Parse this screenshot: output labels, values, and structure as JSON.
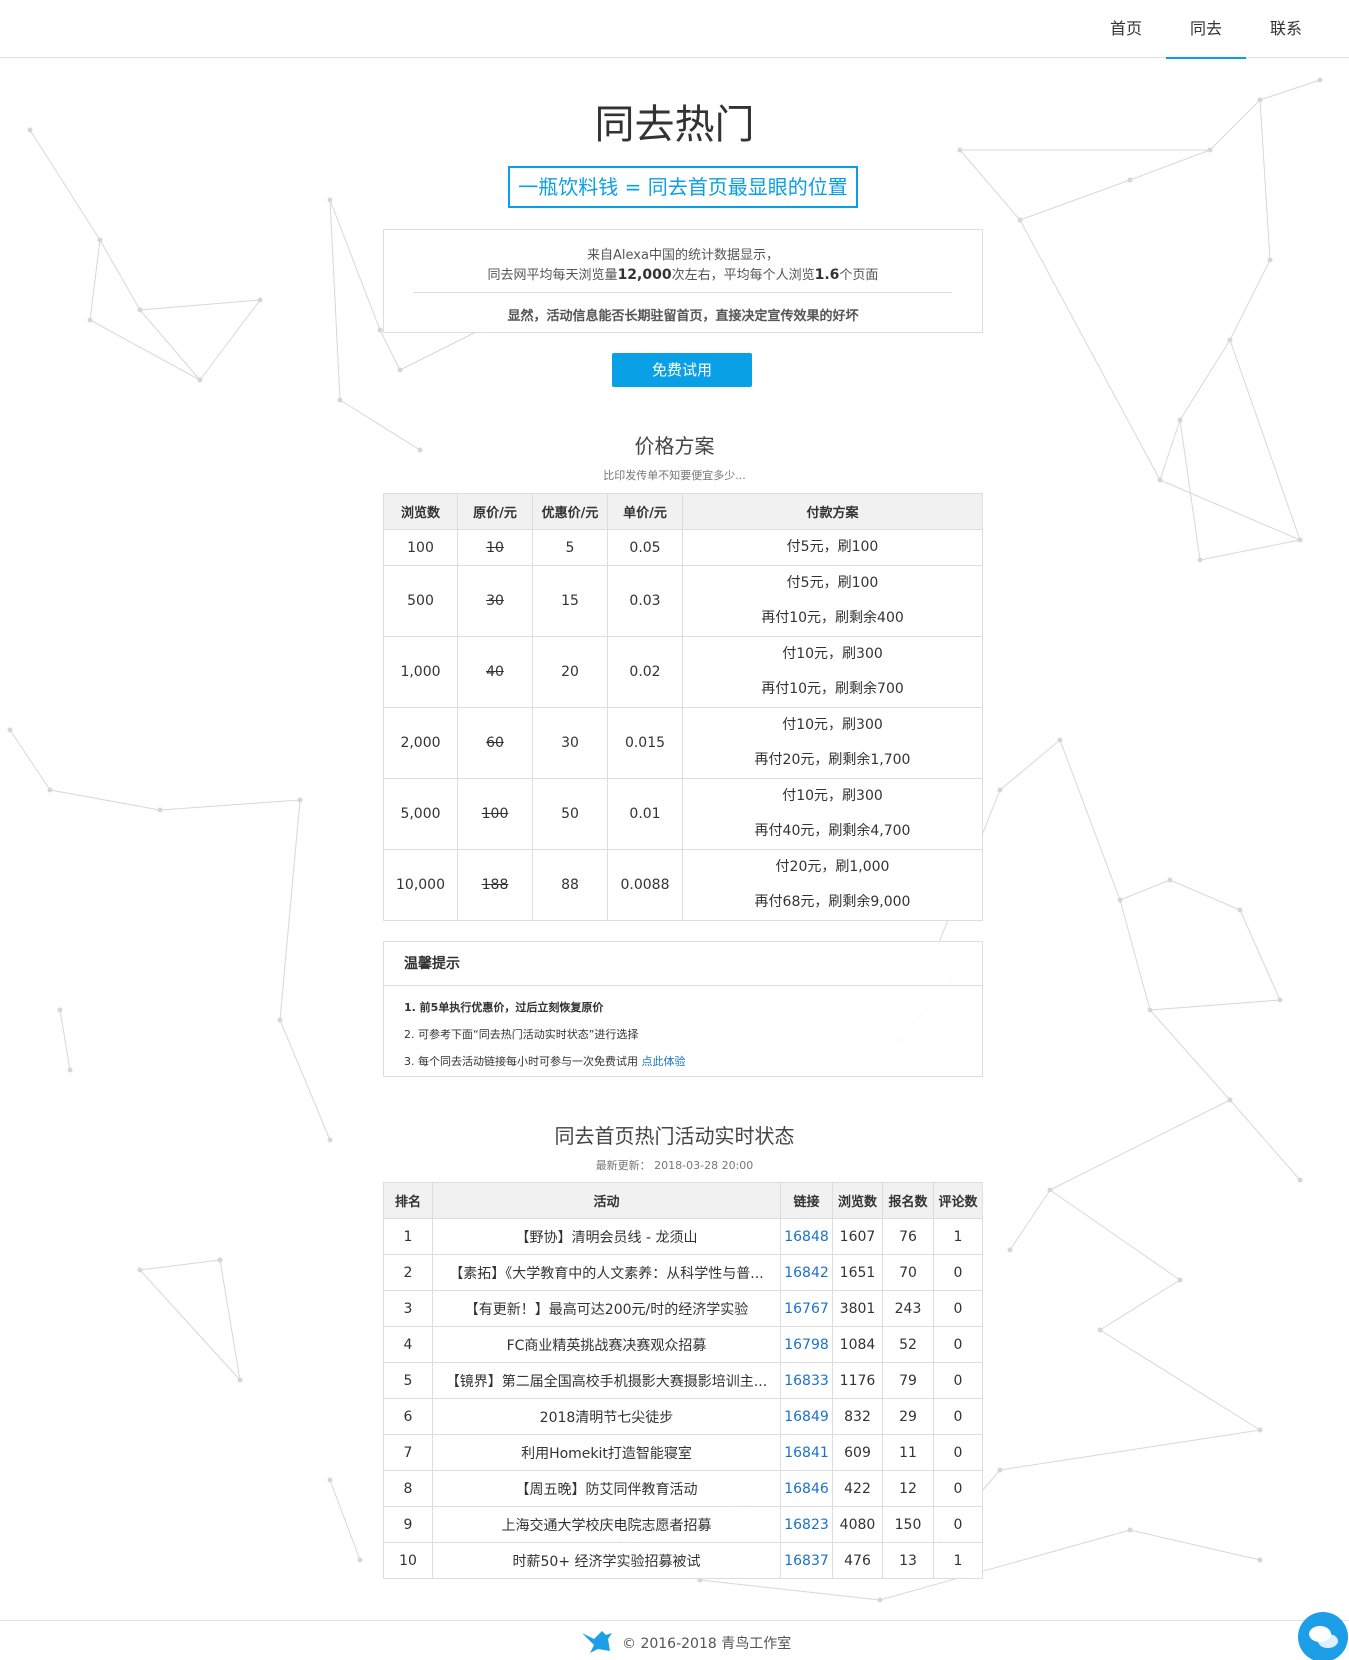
{
  "nav": {
    "items": [
      "首页",
      "同去",
      "联系"
    ],
    "active_index": 1
  },
  "hero": {
    "title": "同去热门",
    "slogan": "一瓶饮料钱 = 同去首页最显眼的位置"
  },
  "stats": {
    "line1": "来自Alexa中国的统计数据显示，",
    "line2_pre": "同去网平均每天浏览量",
    "line2_b1": "12,000",
    "line2_mid": "次左右，平均每个人浏览",
    "line2_b2": "1.6",
    "line2_post": "个页面",
    "line3": "显然，活动信息能否长期驻留首页，直接决定宣传效果的好坏"
  },
  "trial_button": "免费试用",
  "pricing": {
    "title": "价格方案",
    "subtitle": "比印发传单不知要便宜多少...",
    "headers": [
      "浏览数",
      "原价/元",
      "优惠价/元",
      "单价/元",
      "付款方案"
    ],
    "rows": [
      {
        "views": "100",
        "orig": "10",
        "deal": "5",
        "unit": "0.05",
        "plan": [
          "付5元，刷100"
        ]
      },
      {
        "views": "500",
        "orig": "30",
        "deal": "15",
        "unit": "0.03",
        "plan": [
          "付5元，刷100",
          "再付10元，刷剩余400"
        ]
      },
      {
        "views": "1,000",
        "orig": "40",
        "deal": "20",
        "unit": "0.02",
        "plan": [
          "付10元，刷300",
          "再付10元，刷剩余700"
        ]
      },
      {
        "views": "2,000",
        "orig": "60",
        "deal": "30",
        "unit": "0.015",
        "plan": [
          "付10元，刷300",
          "再付20元，刷剩余1,700"
        ]
      },
      {
        "views": "5,000",
        "orig": "100",
        "deal": "50",
        "unit": "0.01",
        "plan": [
          "付10元，刷300",
          "再付40元，刷剩余4,700"
        ]
      },
      {
        "views": "10,000",
        "orig": "188",
        "deal": "88",
        "unit": "0.0088",
        "plan": [
          "付20元，刷1,000",
          "再付68元，刷剩余9,000"
        ]
      }
    ]
  },
  "tips": {
    "title": "温馨提示",
    "item1": "1. 前5单执行优惠价，过后立刻恢复原价",
    "item2": "2. 可参考下面“同去热门活动实时状态”进行选择",
    "item3": "3. 每个同去活动链接每小时可参与一次免费试用 ",
    "item3_link": "点此体验"
  },
  "ranking": {
    "title": "同去首页热门活动实时状态",
    "updated": "最新更新： 2018-03-28 20:00",
    "headers": [
      "排名",
      "活动",
      "链接",
      "浏览数",
      "报名数",
      "评论数"
    ],
    "rows": [
      {
        "rank": "1",
        "name": "【野协】清明会员线 - 龙须山",
        "link": "16848",
        "views": "1607",
        "signups": "76",
        "comments": "1"
      },
      {
        "rank": "2",
        "name": "【素拓】《大学教育中的人文素养：从科学性与普...",
        "link": "16842",
        "views": "1651",
        "signups": "70",
        "comments": "0"
      },
      {
        "rank": "3",
        "name": "【有更新！】最高可达200元/时的经济学实验",
        "link": "16767",
        "views": "3801",
        "signups": "243",
        "comments": "0"
      },
      {
        "rank": "4",
        "name": "FC商业精英挑战赛决赛观众招募",
        "link": "16798",
        "views": "1084",
        "signups": "52",
        "comments": "0"
      },
      {
        "rank": "5",
        "name": "【镜界】第二届全国高校手机摄影大赛摄影培训主...",
        "link": "16833",
        "views": "1176",
        "signups": "79",
        "comments": "0"
      },
      {
        "rank": "6",
        "name": "2018清明节七尖徒步",
        "link": "16849",
        "views": "832",
        "signups": "29",
        "comments": "0"
      },
      {
        "rank": "7",
        "name": "利用Homekit打造智能寝室",
        "link": "16841",
        "views": "609",
        "signups": "11",
        "comments": "0"
      },
      {
        "rank": "8",
        "name": "【周五晚】防艾同伴教育活动",
        "link": "16846",
        "views": "422",
        "signups": "12",
        "comments": "0"
      },
      {
        "rank": "9",
        "name": "上海交通大学校庆电院志愿者招募",
        "link": "16823",
        "views": "4080",
        "signups": "150",
        "comments": "0"
      },
      {
        "rank": "10",
        "name": "时薪50+ 经济学实验招募被试",
        "link": "16837",
        "views": "476",
        "signups": "13",
        "comments": "1"
      }
    ]
  },
  "footer": {
    "text": "© 2016-2018 青鸟工作室"
  },
  "colors": {
    "accent": "#0aa0e6",
    "link": "#1a73c9",
    "border": "#dddddd",
    "header_bg": "#f1f1f1"
  },
  "icons": {
    "footer_logo": "bird-icon",
    "chat": "chat-bubble-icon"
  }
}
